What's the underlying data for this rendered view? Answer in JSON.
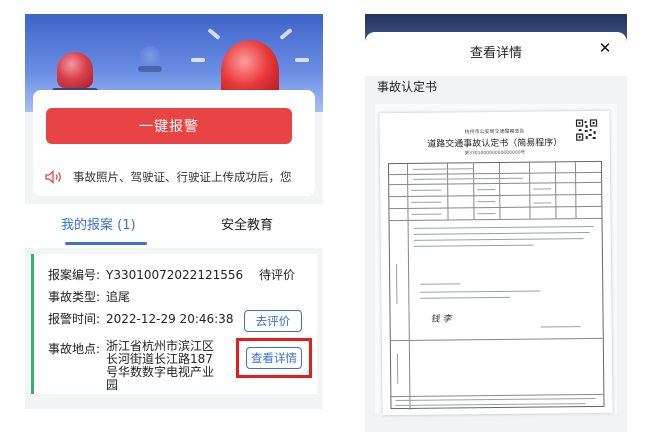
{
  "left_panel": {
    "alarm_button": "一键报警",
    "notice": "事故照片、驾驶证、行驶证上传成功后，您",
    "tabs": [
      {
        "label": "我的报案 (1)",
        "active": true
      },
      {
        "label": "安全教育",
        "active": false
      }
    ],
    "case": {
      "fields": [
        {
          "key": "报案编号:",
          "value": "Y33010072022121556"
        },
        {
          "key": "事故类型:",
          "value": "追尾"
        },
        {
          "key": "报警时间:",
          "value": "2022-12-29 20:46:38"
        },
        {
          "key": "事故地点:",
          "value": "浙江省杭州市滨江区长河街道长江路187号华数数字电视产业园"
        }
      ],
      "status": "待评价",
      "rate_button": "去评价",
      "detail_button": "查看详情"
    }
  },
  "right_panel": {
    "modal_title": "查看详情",
    "close_icon": "close-icon",
    "section_label": "事故认定书",
    "document": {
      "header_small": "杭州市公安局交通警察支队",
      "title": "道路交通事故认定书（简易程序）",
      "number": "第330100000000000000号",
      "signature": "钱  李"
    }
  },
  "colors": {
    "accent_blue": "#3b6fd1",
    "alarm_red": "#e84446",
    "highlight_red": "#e41e1e",
    "case_green": "#35b36c"
  }
}
